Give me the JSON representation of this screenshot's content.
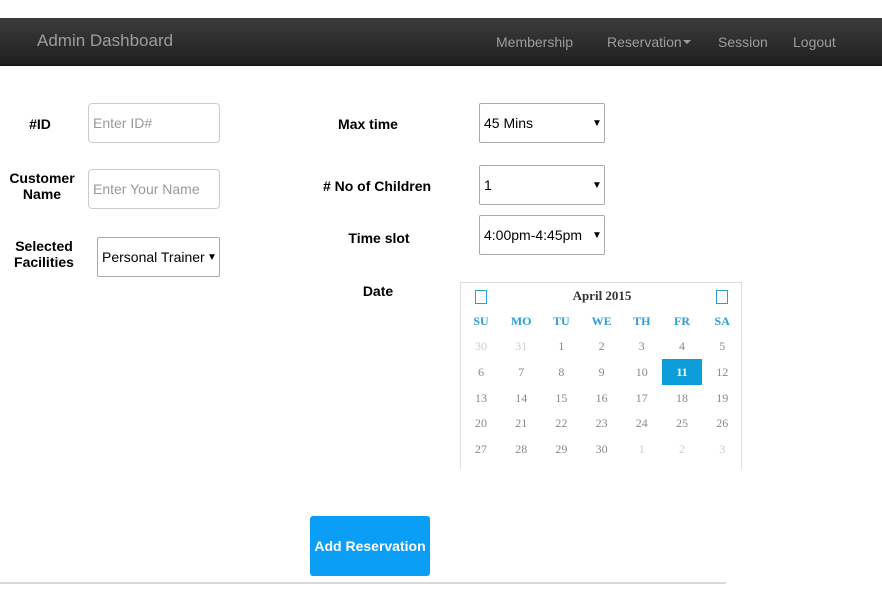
{
  "navbar": {
    "brand": "Admin Dashboard",
    "links": [
      "Membership",
      "Reservation",
      "Session",
      "Logout"
    ]
  },
  "form": {
    "id_label": "#ID",
    "id_placeholder": "Enter ID#",
    "customer_label_1": "Customer",
    "customer_label_2": "Name",
    "customer_placeholder": "Enter Your Name",
    "facilities_label_1": "Selected",
    "facilities_label_2": "Facilities",
    "facilities_value": "Personal Trainer",
    "max_time_label": "Max time",
    "max_time_value": "45 Mins",
    "children_label": "# No of Children",
    "children_value": "1",
    "timeslot_label": "Time slot",
    "timeslot_value": "4:00pm-4:45pm",
    "date_label": "Date",
    "submit_label": "Add Reservation"
  },
  "calendar": {
    "title": "April 2015",
    "weekdays": [
      "SU",
      "MO",
      "TU",
      "WE",
      "TH",
      "FR",
      "SA"
    ],
    "selected_day": "11",
    "weeks": [
      [
        [
          "30",
          true
        ],
        [
          "31",
          true
        ],
        [
          "1",
          false
        ],
        [
          "2",
          false
        ],
        [
          "3",
          false
        ],
        [
          "4",
          false
        ],
        [
          "5",
          false
        ]
      ],
      [
        [
          "6",
          false
        ],
        [
          "7",
          false
        ],
        [
          "8",
          false
        ],
        [
          "9",
          false
        ],
        [
          "10",
          false
        ],
        [
          "11",
          false
        ],
        [
          "12",
          false
        ]
      ],
      [
        [
          "13",
          false
        ],
        [
          "14",
          false
        ],
        [
          "15",
          false
        ],
        [
          "16",
          false
        ],
        [
          "17",
          false
        ],
        [
          "18",
          false
        ],
        [
          "19",
          false
        ]
      ],
      [
        [
          "20",
          false
        ],
        [
          "21",
          false
        ],
        [
          "22",
          false
        ],
        [
          "23",
          false
        ],
        [
          "24",
          false
        ],
        [
          "25",
          false
        ],
        [
          "26",
          false
        ]
      ],
      [
        [
          "27",
          false
        ],
        [
          "28",
          false
        ],
        [
          "29",
          false
        ],
        [
          "30",
          false
        ],
        [
          "1",
          true
        ],
        [
          "2",
          true
        ],
        [
          "3",
          true
        ]
      ]
    ],
    "colors": {
      "accent": "#2a9fd6",
      "selected": "#0d9ddb"
    }
  },
  "colors": {
    "navbar": "#2b2b2b",
    "button": "#0a9ef7"
  }
}
